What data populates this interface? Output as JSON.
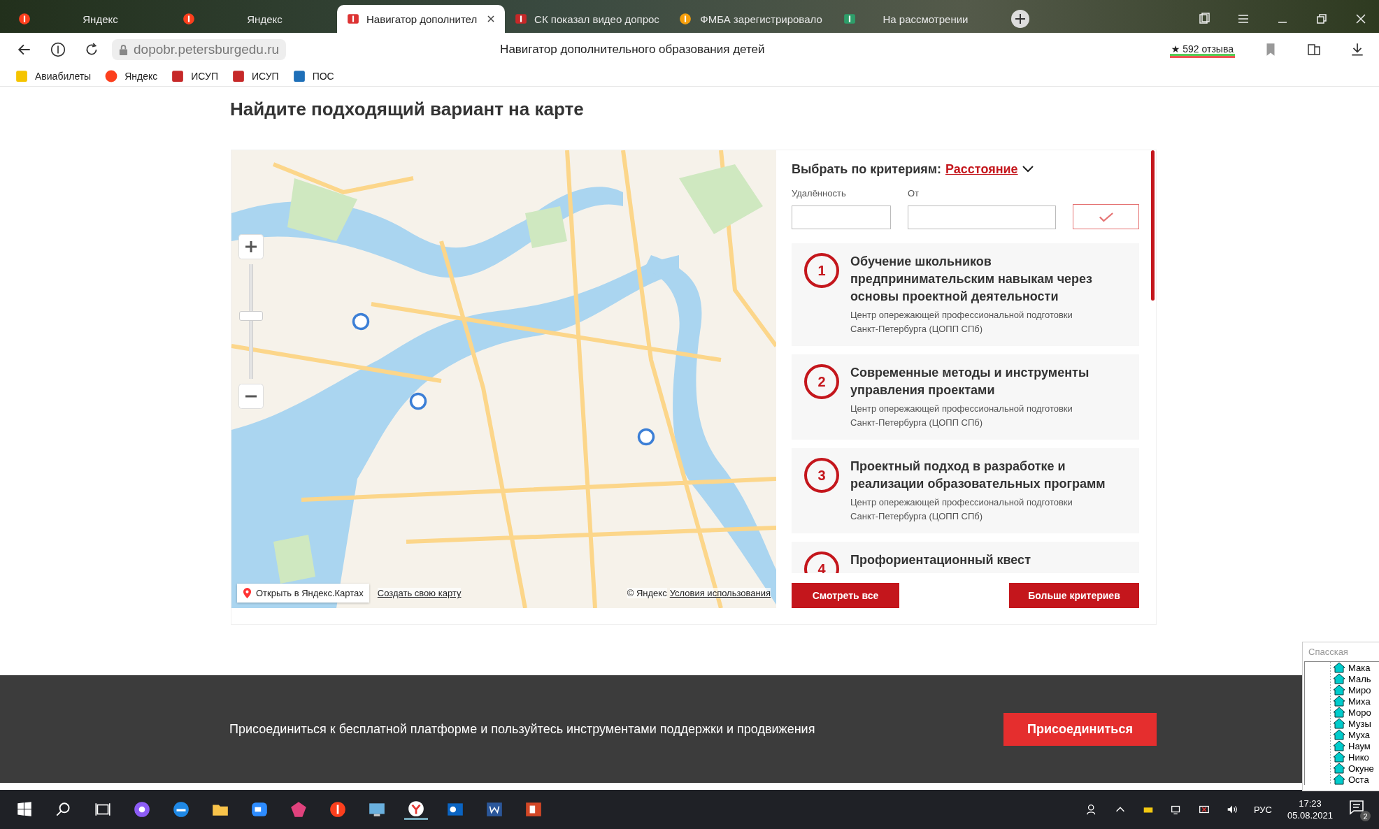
{
  "browser": {
    "tabs": [
      {
        "title": "Яндекс",
        "selected": false
      },
      {
        "title": "Яндекс",
        "selected": false
      },
      {
        "title": "Навигатор дополнител",
        "selected": true
      },
      {
        "title": "СК показал видео допрос",
        "selected": false
      },
      {
        "title": "ФМБА зарегистрировало",
        "selected": false
      },
      {
        "title": "На рассмотрении",
        "selected": false
      }
    ],
    "url": "dopobr.petersburgedu.ru",
    "page_title": "Навигатор дополнительного образования детей",
    "reviews": "★ 592 отзыва",
    "bookmarks": [
      {
        "label": "Авиабилеты"
      },
      {
        "label": "Яндекс"
      },
      {
        "label": "ИСУП"
      },
      {
        "label": "ИСУП"
      },
      {
        "label": "ПОС"
      }
    ]
  },
  "page": {
    "heading": "Найдите подходящий вариант на карте",
    "map": {
      "zoom": {
        "level": 0.55
      },
      "open_link": "Открыть в Яндекс.Картах",
      "create_link": "Создать свою карту",
      "copyright": "© Яндекс",
      "terms": "Условия использования"
    },
    "criteria": {
      "label": "Выбрать по критериям:",
      "value": "Расстояние",
      "fields": [
        {
          "label": "Удалённость"
        },
        {
          "label": "От"
        }
      ]
    },
    "results": [
      {
        "number": "1",
        "title": "Обучение школьников предпринимательским навыкам через основы проектной деятельности",
        "organization": "Центр опережающей профессиональной подготовки Санкт-Петербурга (ЦОПП СПб)"
      },
      {
        "number": "2",
        "title": "Современные методы и инструменты управления проектами",
        "organization": "Центр опережающей профессиональной подготовки Санкт-Петербурга (ЦОПП СПб)"
      },
      {
        "number": "3",
        "title": "Проектный подход в разработке и реализации образовательных программ",
        "organization": "Центр опережающей профессиональной подготовки Санкт-Петербурга (ЦОПП СПб)"
      },
      {
        "number": "4",
        "title": "Профориентационный квест"
      }
    ],
    "buttons": [
      "Смотреть все",
      "Больше критериев"
    ]
  },
  "footer": {
    "text": "Присоединиться к бесплатной платформе и пользуйтесь инструментами поддержки и продвижения",
    "button": "Присоединиться"
  },
  "tree_window": {
    "title": "Спасская",
    "items": [
      "Мака",
      "Маль",
      "Миро",
      "Миха",
      "Моро",
      "Музы",
      "Муха",
      "Наум",
      "Нико",
      "Окуне",
      "Оста"
    ]
  },
  "taskbar": {
    "language": "РУС",
    "time": "17:23",
    "date": "05.08.2021",
    "notifications": "2"
  }
}
